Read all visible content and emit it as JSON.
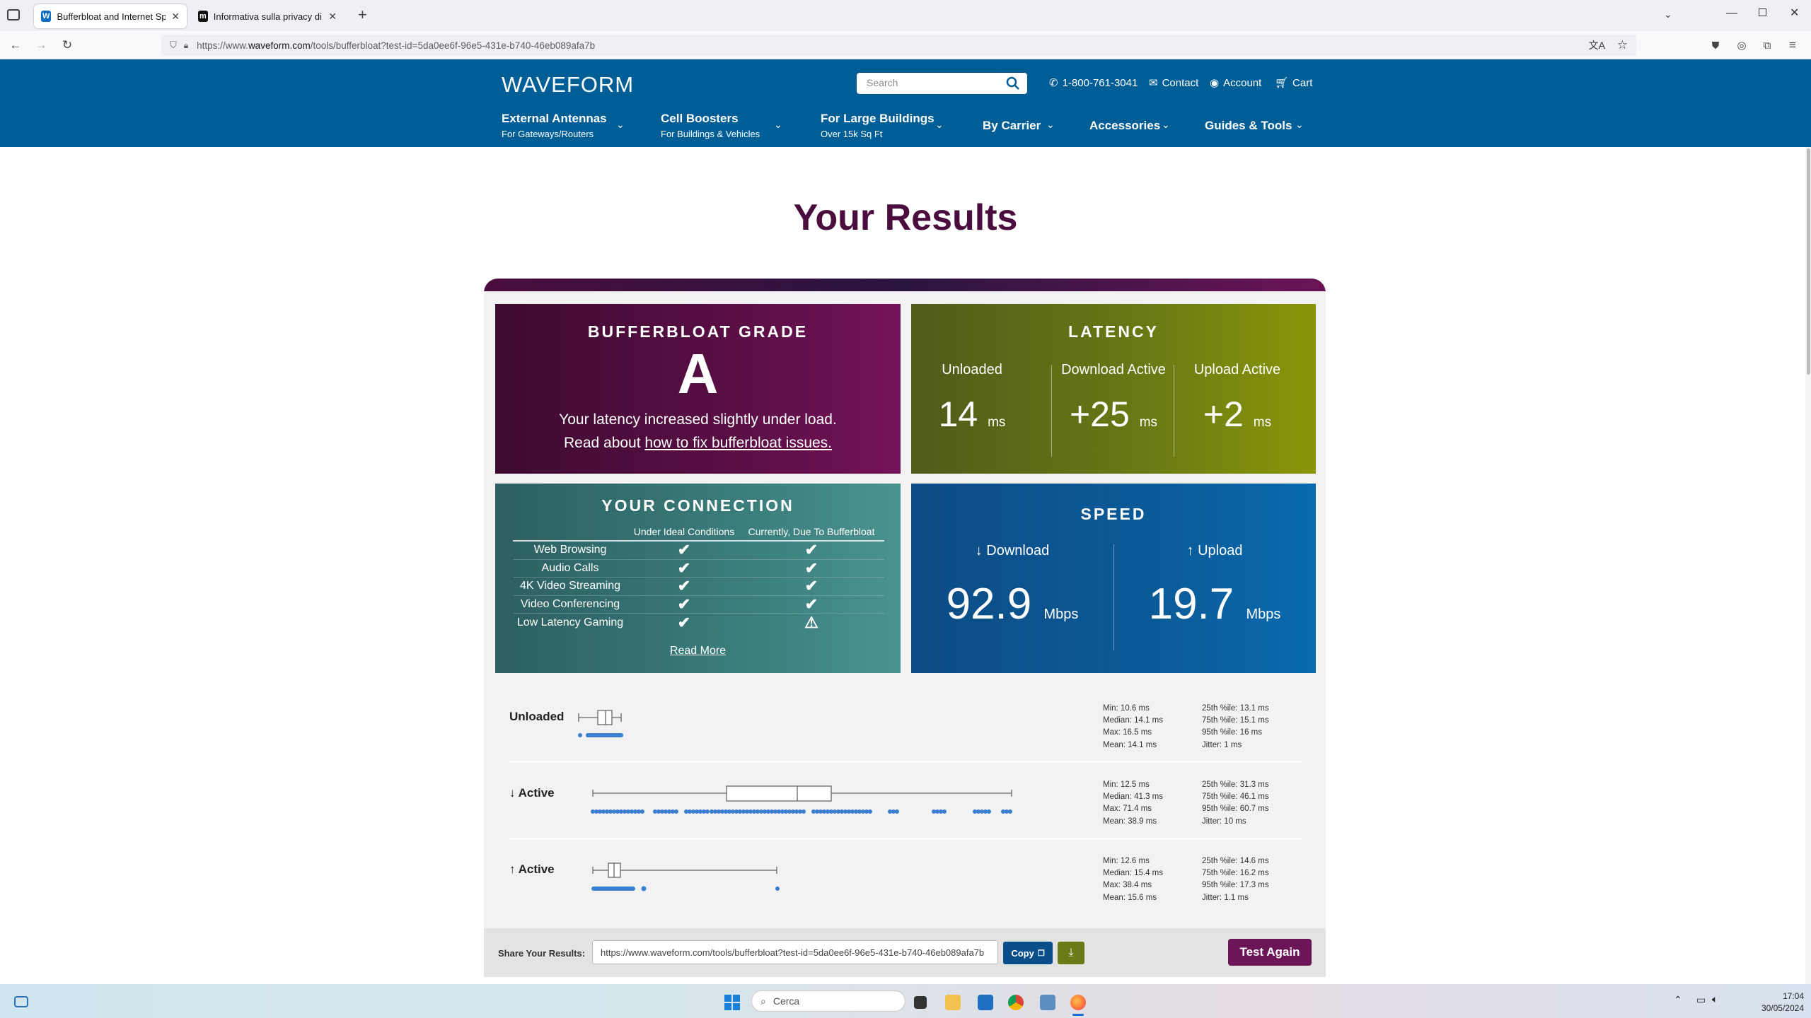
{
  "browser": {
    "tabs": [
      {
        "title": "Bufferbloat and Internet Speed",
        "active": true
      },
      {
        "title": "Informativa sulla privacy di Fire",
        "active": false
      }
    ],
    "url_prefix": "https://www.",
    "url_domain": "waveform.com",
    "url_rest": "/tools/bufferbloat?test-id=5da0ee6f-96e5-431e-b740-46eb089afa7b"
  },
  "site": {
    "logo": "WAVEFORM",
    "search_placeholder": "Search",
    "phone": "1-800-761-3041",
    "contact": "Contact",
    "account": "Account",
    "cart": "Cart",
    "menu": [
      {
        "title": "External Antennas",
        "sub": "For Gateways/Routers"
      },
      {
        "title": "Cell Boosters",
        "sub": "For Buildings & Vehicles"
      },
      {
        "title": "For Large Buildings",
        "sub": "Over 15k Sq Ft"
      },
      {
        "title": "By Carrier",
        "sub": ""
      },
      {
        "title": "Accessories",
        "sub": ""
      },
      {
        "title": "Guides & Tools",
        "sub": ""
      }
    ]
  },
  "page_title": "Your Results",
  "grade": {
    "title": "BUFFERBLOAT GRADE",
    "value": "A",
    "line1": "Your latency increased slightly under load.",
    "line2_prefix": "Read about ",
    "line2_link": "how to fix bufferbloat issues."
  },
  "latency": {
    "title": "LATENCY",
    "cols": [
      {
        "label": "Unloaded",
        "value": "14",
        "unit": "ms"
      },
      {
        "label": "Download Active",
        "value": "+25",
        "unit": "ms"
      },
      {
        "label": "Upload Active",
        "value": "+2",
        "unit": "ms"
      }
    ]
  },
  "connection": {
    "title": "YOUR CONNECTION",
    "col_ideal": "Under Ideal Conditions",
    "col_current": "Currently, Due To Bufferbloat",
    "rows": [
      {
        "name": "Web Browsing",
        "ideal": "✔",
        "current": "✔"
      },
      {
        "name": "Audio Calls",
        "ideal": "✔",
        "current": "✔"
      },
      {
        "name": "4K Video Streaming",
        "ideal": "✔",
        "current": "✔"
      },
      {
        "name": "Video Conferencing",
        "ideal": "✔",
        "current": "✔"
      },
      {
        "name": "Low Latency Gaming",
        "ideal": "✔",
        "current": "⚠"
      }
    ],
    "read_more": "Read More"
  },
  "speed": {
    "title": "SPEED",
    "download_label": "↓ Download",
    "download_value": "92.9",
    "upload_label": "↑ Upload",
    "upload_value": "19.7",
    "unit": "Mbps"
  },
  "boxplots": [
    {
      "label": "Unloaded",
      "stats_left": [
        "Min: 10.6 ms",
        "Median: 14.1 ms",
        "Max: 16.5 ms",
        "Mean: 14.1 ms"
      ],
      "stats_right": [
        "25th %ile: 13.1 ms",
        "75th %ile: 15.1 ms",
        "95th %ile: 16 ms",
        "Jitter: 1 ms"
      ]
    },
    {
      "label": "↓ Active",
      "stats_left": [
        "Min: 12.5 ms",
        "Median: 41.3 ms",
        "Max: 71.4 ms",
        "Mean: 38.9 ms"
      ],
      "stats_right": [
        "25th %ile: 31.3 ms",
        "75th %ile: 46.1 ms",
        "95th %ile: 60.7 ms",
        "Jitter: 10 ms"
      ]
    },
    {
      "label": "↑ Active",
      "stats_left": [
        "Min: 12.6 ms",
        "Median: 15.4 ms",
        "Max: 38.4 ms",
        "Mean: 15.6 ms"
      ],
      "stats_right": [
        "25th %ile: 14.6 ms",
        "75th %ile: 16.2 ms",
        "95th %ile: 17.3 ms",
        "Jitter: 1.1 ms"
      ]
    }
  ],
  "share": {
    "label": "Share Your Results:",
    "url": "https://www.waveform.com/tools/bufferbloat?test-id=5da0ee6f-96e5-431e-b740-46eb089afa7b",
    "copy": "Copy",
    "test_again": "Test Again"
  },
  "taskbar": {
    "search": "Cerca",
    "time": "17:04",
    "date": "30/05/2024"
  },
  "colors": {
    "header": "#005e97",
    "grade": "#5a0f45",
    "latency": "#6b7a14",
    "connection": "#3a7d7b",
    "speed": "#0b5a98",
    "plot_points": "#3a7fd0"
  }
}
